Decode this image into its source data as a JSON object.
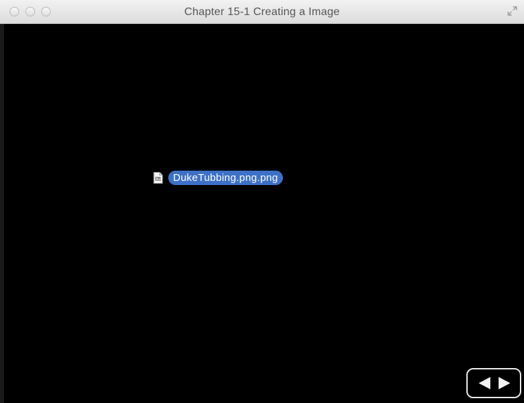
{
  "window": {
    "title": "Chapter 15-1 Creating a Image",
    "controls": {
      "close_icon": "close-icon",
      "minimize_icon": "minimize-icon",
      "zoom_icon": "zoom-icon",
      "fullscreen_icon": "fullscreen-icon"
    }
  },
  "content": {
    "background_color": "#000000",
    "file": {
      "name": "DukeTubbing.png.png",
      "icon": "png-file-icon",
      "selection_color": "#3d71c7"
    }
  },
  "navigation": {
    "previous_icon": "previous-arrow-icon",
    "next_icon": "next-arrow-icon"
  }
}
